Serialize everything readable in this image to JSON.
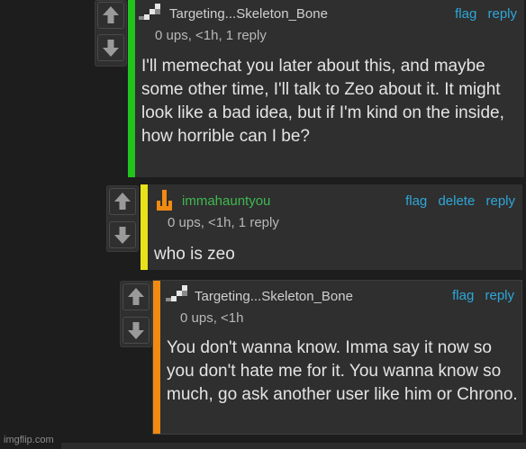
{
  "colors": {
    "accent_green": "#22c21f",
    "accent_yellow": "#e8e21a",
    "accent_orange": "#f08a12",
    "link": "#2ea7d8",
    "username_green": "#3fb950"
  },
  "comments": [
    {
      "username": "Targeting...Skeleton_Bone",
      "meta": "0 ups, <1h, 1 reply",
      "actions": [
        "flag",
        "reply"
      ],
      "text": "I'll memechat you later about this, and maybe some other time, I'll talk to Zeo about it. It might look like a bad idea, but if I'm kind on the inside, how horrible can I be?",
      "avatar_icon": "pixel-staircase-avatar",
      "accent": "green"
    },
    {
      "username": "immahauntyou",
      "meta": "0 ups, <1h, 1 reply",
      "actions": [
        "flag",
        "delete",
        "reply"
      ],
      "text": "who is zeo",
      "avatar_icon": "orange-anchor-avatar",
      "accent": "yellow"
    },
    {
      "username": "Targeting...Skeleton_Bone",
      "meta": "0 ups, <1h",
      "actions": [
        "flag",
        "reply"
      ],
      "text": "You don't wanna know. Imma say it now so you don't hate me for it. You wanna know so much, go ask another user like him or Chrono.",
      "avatar_icon": "pixel-staircase-avatar",
      "accent": "orange"
    }
  ],
  "vote_icons": [
    "upvote-arrow-icon",
    "downvote-arrow-icon"
  ],
  "watermark": "imgflip.com"
}
